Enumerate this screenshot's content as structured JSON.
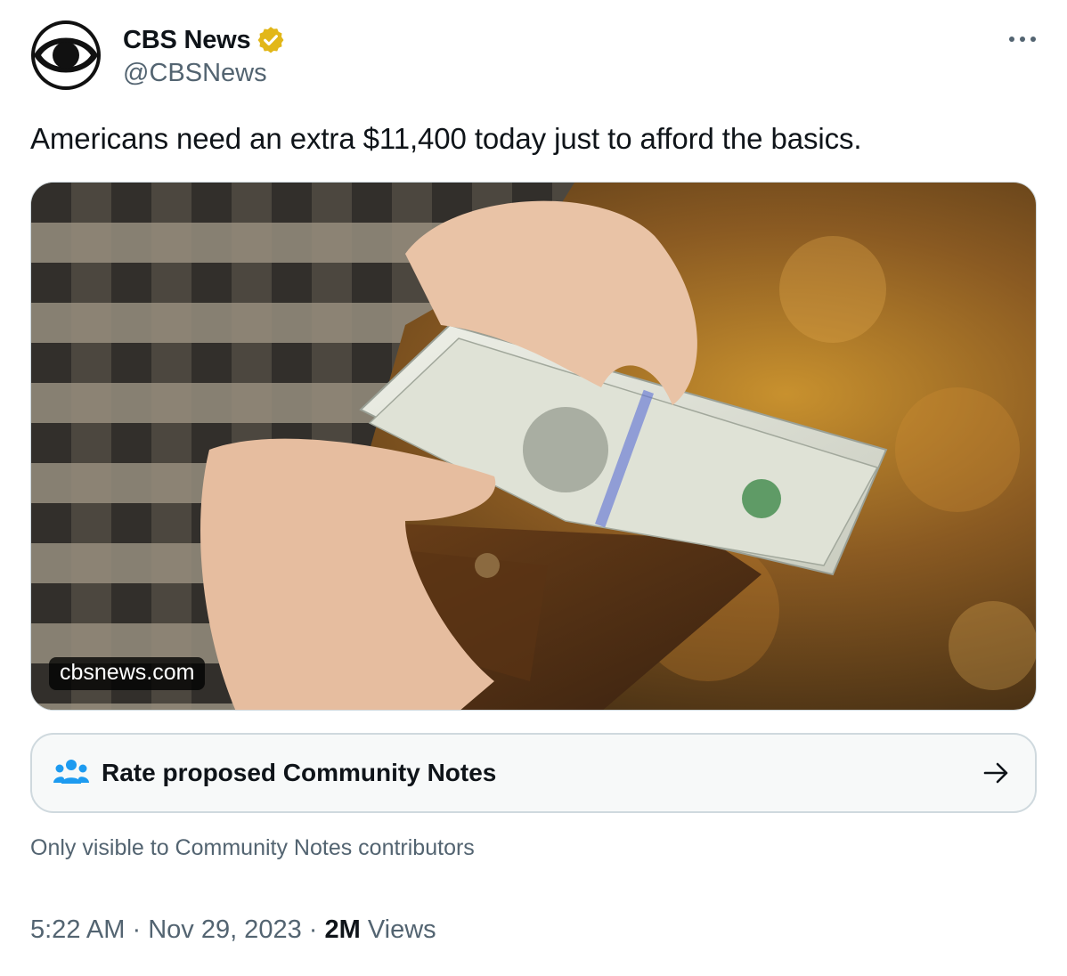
{
  "author": {
    "display_name": "CBS News",
    "handle": "@CBSNews",
    "verified_badge": "gold-verified-badge",
    "avatar_icon": "cbs-eye-logo"
  },
  "tweet": {
    "text": "Americans need an extra $11,400 today just to afford the basics.",
    "media": {
      "domain_label": "cbsnews.com",
      "image_desc": "hands-holding-100-dollar-bills-over-leather-wallet"
    },
    "community_notes": {
      "label": "Rate proposed Community Notes",
      "icon": "people-icon",
      "arrow_icon": "arrow-right-icon",
      "subtext": "Only visible to Community Notes contributors"
    },
    "meta": {
      "time": "5:22 AM",
      "separator": " · ",
      "date": "Nov 29, 2023",
      "views_count": "2M",
      "views_label": " Views"
    },
    "more_icon": "more-horizontal-icon"
  },
  "colors": {
    "text_primary": "#0f1419",
    "text_secondary": "#536471",
    "verified_gold": "#e2b719",
    "community_blue": "#1d9bf0",
    "border": "#cfd9de"
  }
}
